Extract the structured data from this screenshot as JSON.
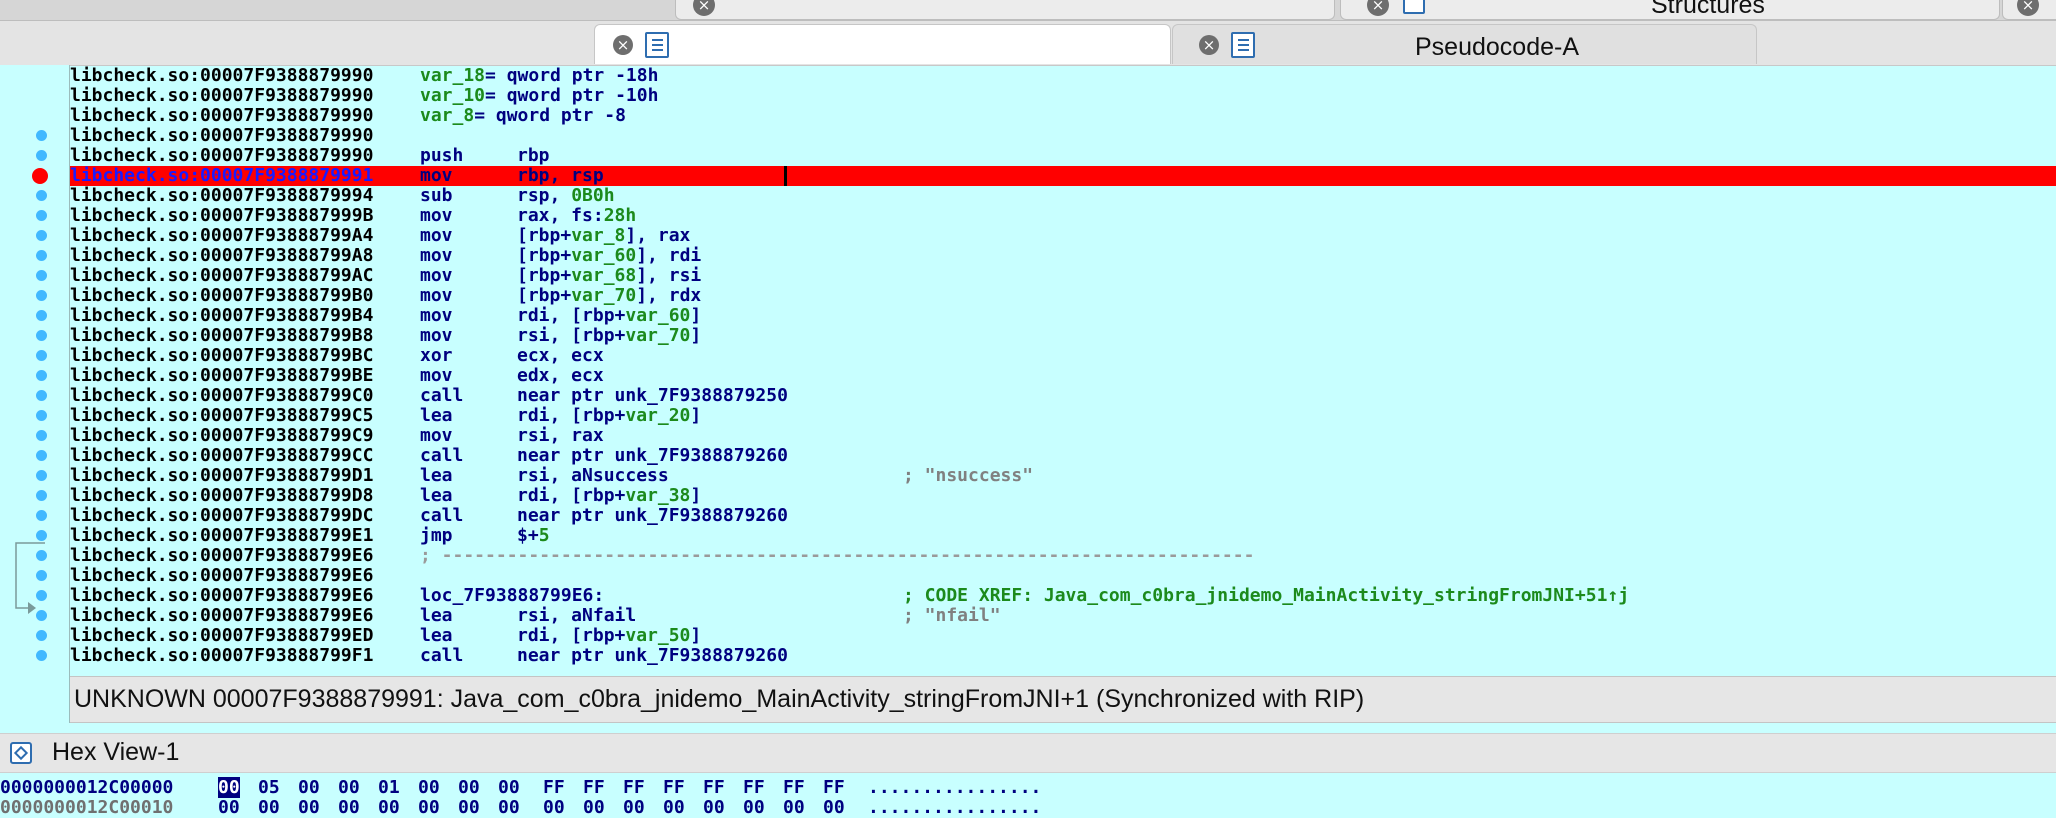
{
  "top_tabs": {
    "structures_label": "Structures"
  },
  "tabs": {
    "tab1_label": "",
    "tab2_label": "Pseudocode-A"
  },
  "listing": {
    "lines": [
      {
        "addr": "libcheck.so:00007F9388879990",
        "parts": [
          {
            "t": "var_18",
            "c": "g"
          },
          {
            "t": "= qword ptr -18h",
            "c": ""
          }
        ]
      },
      {
        "addr": "libcheck.so:00007F9388879990",
        "parts": [
          {
            "t": "var_10",
            "c": "g"
          },
          {
            "t": "= qword ptr -10h",
            "c": ""
          }
        ]
      },
      {
        "addr": "libcheck.so:00007F9388879990",
        "parts": [
          {
            "t": "var_8",
            "c": "g"
          },
          {
            "t": "= qword ptr -8",
            "c": ""
          }
        ]
      },
      {
        "addr": "libcheck.so:00007F9388879990",
        "parts": []
      },
      {
        "addr": "libcheck.so:00007F9388879990",
        "mn": "push",
        "op": [
          {
            "t": "rbp",
            "c": ""
          }
        ]
      },
      {
        "addr": "libcheck.so:00007F9388879991",
        "mn": "mov",
        "op": [
          {
            "t": "rbp, rsp",
            "c": ""
          }
        ],
        "hl": true
      },
      {
        "addr": "libcheck.so:00007F9388879994",
        "mn": "sub",
        "op": [
          {
            "t": "rsp, ",
            "c": ""
          },
          {
            "t": "0B0h",
            "c": "g"
          }
        ]
      },
      {
        "addr": "libcheck.so:00007F938887999B",
        "mn": "mov",
        "op": [
          {
            "t": "rax, fs:",
            "c": ""
          },
          {
            "t": "28h",
            "c": "g"
          }
        ]
      },
      {
        "addr": "libcheck.so:00007F93888799A4",
        "mn": "mov",
        "op": [
          {
            "t": "[rbp+",
            "c": ""
          },
          {
            "t": "var_8",
            "c": "g"
          },
          {
            "t": "], rax",
            "c": ""
          }
        ]
      },
      {
        "addr": "libcheck.so:00007F93888799A8",
        "mn": "mov",
        "op": [
          {
            "t": "[rbp+",
            "c": ""
          },
          {
            "t": "var_60",
            "c": "g"
          },
          {
            "t": "], rdi",
            "c": ""
          }
        ]
      },
      {
        "addr": "libcheck.so:00007F93888799AC",
        "mn": "mov",
        "op": [
          {
            "t": "[rbp+",
            "c": ""
          },
          {
            "t": "var_68",
            "c": "g"
          },
          {
            "t": "], rsi",
            "c": ""
          }
        ]
      },
      {
        "addr": "libcheck.so:00007F93888799B0",
        "mn": "mov",
        "op": [
          {
            "t": "[rbp+",
            "c": ""
          },
          {
            "t": "var_70",
            "c": "g"
          },
          {
            "t": "], rdx",
            "c": ""
          }
        ]
      },
      {
        "addr": "libcheck.so:00007F93888799B4",
        "mn": "mov",
        "op": [
          {
            "t": "rdi, [rbp+",
            "c": ""
          },
          {
            "t": "var_60",
            "c": "g"
          },
          {
            "t": "]",
            "c": ""
          }
        ]
      },
      {
        "addr": "libcheck.so:00007F93888799B8",
        "mn": "mov",
        "op": [
          {
            "t": "rsi, [rbp+",
            "c": ""
          },
          {
            "t": "var_70",
            "c": "g"
          },
          {
            "t": "]",
            "c": ""
          }
        ]
      },
      {
        "addr": "libcheck.so:00007F93888799BC",
        "mn": "xor",
        "op": [
          {
            "t": "ecx, ecx",
            "c": ""
          }
        ]
      },
      {
        "addr": "libcheck.so:00007F93888799BE",
        "mn": "mov",
        "op": [
          {
            "t": "edx, ecx",
            "c": ""
          }
        ]
      },
      {
        "addr": "libcheck.so:00007F93888799C0",
        "mn": "call",
        "op": [
          {
            "t": "near ptr unk_7F9388879250",
            "c": ""
          }
        ]
      },
      {
        "addr": "libcheck.so:00007F93888799C5",
        "mn": "lea",
        "op": [
          {
            "t": "rdi, [rbp+",
            "c": ""
          },
          {
            "t": "var_20",
            "c": "g"
          },
          {
            "t": "]",
            "c": ""
          }
        ]
      },
      {
        "addr": "libcheck.so:00007F93888799C9",
        "mn": "mov",
        "op": [
          {
            "t": "rsi, rax",
            "c": ""
          }
        ]
      },
      {
        "addr": "libcheck.so:00007F93888799CC",
        "mn": "call",
        "op": [
          {
            "t": "near ptr unk_7F9388879260",
            "c": ""
          }
        ]
      },
      {
        "addr": "libcheck.so:00007F93888799D1",
        "mn": "lea",
        "op": [
          {
            "t": "rsi, aNsuccess",
            "c": ""
          }
        ],
        "cmt": [
          {
            "t": "; \"nsuccess\"",
            "c": "cm"
          }
        ]
      },
      {
        "addr": "libcheck.so:00007F93888799D8",
        "mn": "lea",
        "op": [
          {
            "t": "rdi, [rbp+",
            "c": ""
          },
          {
            "t": "var_38",
            "c": "g"
          },
          {
            "t": "]",
            "c": ""
          }
        ]
      },
      {
        "addr": "libcheck.so:00007F93888799DC",
        "mn": "call",
        "op": [
          {
            "t": "near ptr unk_7F9388879260",
            "c": ""
          }
        ]
      },
      {
        "addr": "libcheck.so:00007F93888799E1",
        "mn": "jmp",
        "op": [
          {
            "t": "$+",
            "c": ""
          },
          {
            "t": "5",
            "c": "g"
          }
        ]
      },
      {
        "addr": "libcheck.so:00007F93888799E6",
        "parts": [
          {
            "t": "; ---------------------------------------------------------------------------",
            "c": "sep"
          }
        ]
      },
      {
        "addr": "libcheck.so:00007F93888799E6",
        "parts": []
      },
      {
        "addr": "libcheck.so:00007F93888799E6",
        "label": "loc_7F93888799E6:",
        "cmt": [
          {
            "t": "; CODE XREF: Java_com_c0bra_jnidemo_MainActivity_stringFromJNI+51↑j",
            "c": "xr"
          }
        ]
      },
      {
        "addr": "libcheck.so:00007F93888799E6",
        "mn": "lea",
        "op": [
          {
            "t": "rsi, aNfail",
            "c": ""
          }
        ],
        "cmt": [
          {
            "t": "; \"nfail\"",
            "c": "cm"
          }
        ]
      },
      {
        "addr": "libcheck.so:00007F93888799ED",
        "mn": "lea",
        "op": [
          {
            "t": "rdi, [rbp+",
            "c": ""
          },
          {
            "t": "var_50",
            "c": "g"
          },
          {
            "t": "]",
            "c": ""
          }
        ]
      },
      {
        "addr": "libcheck.so:00007F93888799F1",
        "mn": "call",
        "op": [
          {
            "t": "near ptr unk_7F9388879260",
            "c": ""
          }
        ]
      }
    ]
  },
  "status_bar": {
    "text": "UNKNOWN  00007F9388879991: Java_com_c0bra_jnidemo_MainActivity_stringFromJNI+1  (Synchronized with RIP)"
  },
  "hex_view": {
    "title": "Hex View-1",
    "rows": [
      {
        "addr": "0000000012C00000",
        "bytes": [
          "00",
          "05",
          "00",
          "00",
          "01",
          "00",
          "00",
          "00",
          "FF",
          "FF",
          "FF",
          "FF",
          "FF",
          "FF",
          "FF",
          "FF"
        ],
        "ascii": "................"
      },
      {
        "addr": "0000000012C00010",
        "bytes": [
          "00",
          "00",
          "00",
          "00",
          "00",
          "00",
          "00",
          "00",
          "00",
          "00",
          "00",
          "00",
          "00",
          "00",
          "00",
          "00"
        ],
        "ascii": "................"
      }
    ]
  },
  "colors": {
    "background": "#c8ffff",
    "highlight": "#ff0000",
    "breakpoint": "#41b8ff",
    "keyword": "#000080",
    "variable": "#1c8a1c"
  }
}
